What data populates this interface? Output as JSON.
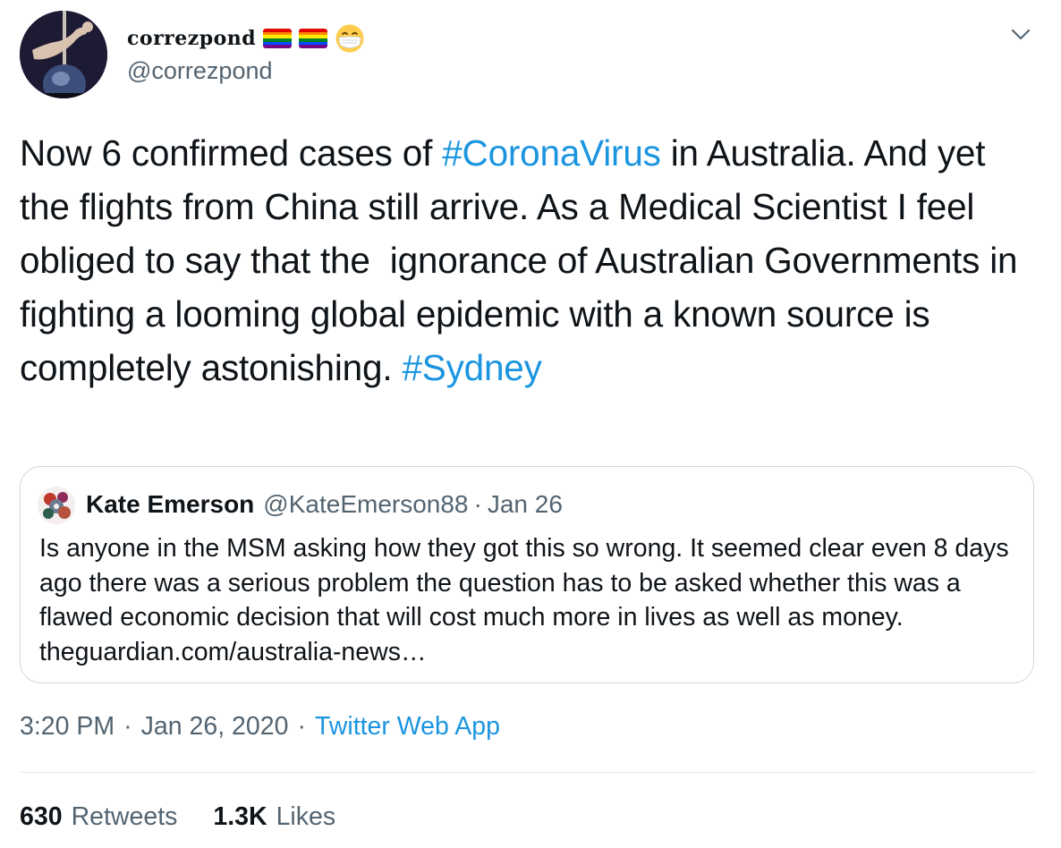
{
  "author": {
    "display_name": "correzpond",
    "handle": "@correzpond",
    "name_emojis": [
      "rainbow-flag",
      "rainbow-flag",
      "face-with-medical-mask"
    ]
  },
  "tweet": {
    "text_before_hashtag": "Now 6 confirmed cases of ",
    "hashtag_1": "#CoronaVirus",
    "text_after_hashtag": " in Australia. And yet the flights from China still arrive. As a Medical Scientist I feel obliged to say that the  ignorance of Australian Governments in fighting a looming global epidemic with a known source is completely astonishing. ",
    "hashtag_2": "#Sydney"
  },
  "quoted_tweet": {
    "name": "Kate Emerson",
    "handle": "@KateEmerson88",
    "separator": "·",
    "date": "Jan 26",
    "text": "Is anyone in the MSM asking how they got this so wrong. It seemed clear even 8 days ago there was a serious problem the question has to be asked whether this was a flawed economic decision that will cost much more in lives as well as money. theguardian.com/australia-news…"
  },
  "meta": {
    "time": "3:20 PM",
    "separator": "·",
    "date": "Jan 26, 2020",
    "source": "Twitter Web App"
  },
  "stats": {
    "retweets_count": "630",
    "retweets_label": "Retweets",
    "likes_count": "1.3K",
    "likes_label": "Likes"
  },
  "colors": {
    "link": "#1b95e0",
    "secondary_text": "#536471",
    "primary_text": "#0f1419",
    "border": "#cfd9de"
  },
  "icons": {
    "more_menu": "chevron-down-icon"
  }
}
